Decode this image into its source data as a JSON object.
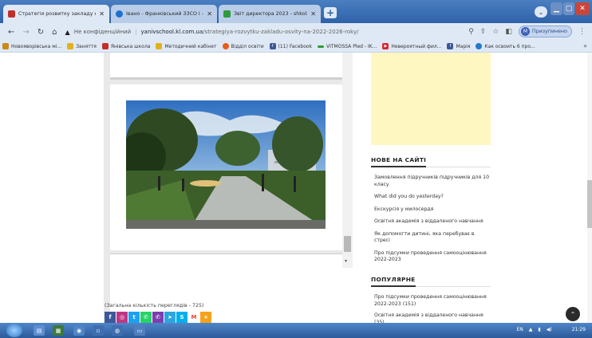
{
  "browser": {
    "tabs": [
      {
        "title": "Стратегія розвитку закладу осв",
        "active": true,
        "icon_color": "#c0302a"
      },
      {
        "title": "Івано - Франківський ЗЗСО І - ІІ",
        "active": false,
        "icon_color": "#1e6fd0"
      },
      {
        "title": "Звіт директора 2023 - shkolayc",
        "active": false,
        "icon_color": "#2d9a3c"
      }
    ],
    "new_tab": "+",
    "address": {
      "insecure_label": "Не конфіденційний",
      "domain": "yanivschool.kl.com.ua",
      "path": "/strategiya-rozvytku-zakladu-osvity-na-2022-2026-roky/"
    },
    "profile_label": "Призупинено",
    "profile_initial": "M",
    "bookmarks": [
      {
        "label": "Новояворівська мі...",
        "icon": "globe-icon",
        "color": "#c98a1a"
      },
      {
        "label": "Заняття",
        "icon": "calendar-icon",
        "color": "#e2b21c"
      },
      {
        "label": "Янівська школа",
        "icon": "school-icon",
        "color": "#c0302a"
      },
      {
        "label": "Методичний кабінет",
        "icon": "book-icon",
        "color": "#e2b21c"
      },
      {
        "label": "Відділ освіти",
        "icon": "dot-icon",
        "color": "#e85d1a"
      },
      {
        "label": "(11) Facebook",
        "icon": "facebook-icon",
        "color": "#3b5998"
      },
      {
        "label": "VITMOSSA Pled - IK...",
        "icon": "dash-icon",
        "color": "#2d9a3c"
      },
      {
        "label": "Невероятный фил...",
        "icon": "youtube-icon",
        "color": "#d9252a"
      },
      {
        "label": "Марія",
        "icon": "facebook-icon",
        "color": "#3b5998"
      },
      {
        "label": "Как освоить 6 про...",
        "icon": "circle-icon",
        "color": "#2878c8"
      }
    ],
    "bookmarks_more": "»"
  },
  "sidebar": {
    "new_heading": "НОВЕ НА САЙТІ",
    "new_items": [
      "Замовлення підручників підручників для 10 класу",
      "What did you do yesterday?",
      "Екскурсія у милосердя",
      "Освітня академія з віддаленого навчання",
      "Як допомогти дитині, яка перебуває в стресі",
      "Про підсумки проведення самооцінювання 2022-2023"
    ],
    "popular_heading": "ПОПУЛЯРНЕ",
    "popular_items": [
      "Про підсумки проведення самооцінювання 2022-2023 (151)",
      "Освітня академія з віддаленого навчання (35)"
    ]
  },
  "footer": {
    "views": "(Загальна кількість переглядів - 725)",
    "share": [
      {
        "name": "facebook-icon",
        "glyph": "f",
        "color": "#3b5998"
      },
      {
        "name": "instagram-icon",
        "glyph": "◎",
        "color": "#c13584"
      },
      {
        "name": "twitter-icon",
        "glyph": "t",
        "color": "#1da1f2"
      },
      {
        "name": "whatsapp-icon",
        "glyph": "✆",
        "color": "#25d366"
      },
      {
        "name": "viber-icon",
        "glyph": "✆",
        "color": "#7d3daf"
      },
      {
        "name": "telegram-icon",
        "glyph": "➤",
        "color": "#2ca5e0"
      },
      {
        "name": "skype-icon",
        "glyph": "S",
        "color": "#00aff0"
      },
      {
        "name": "gmail-icon",
        "glyph": "M",
        "color": "#ea4335"
      },
      {
        "name": "more-share-icon",
        "glyph": "+",
        "color": "#f4a21c"
      }
    ]
  },
  "taskbar": {
    "lang": "EN",
    "time": "21:29"
  }
}
